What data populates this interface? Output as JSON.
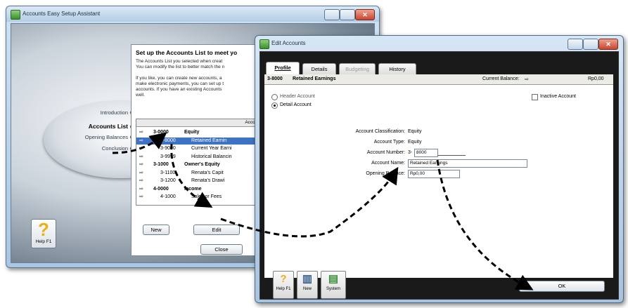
{
  "setup_window": {
    "title": "Accounts Easy Setup Assistant",
    "steps": [
      "Introduction",
      "Accounts List",
      "Opening Balances",
      "Conclusion"
    ],
    "panel_title": "Set up the Accounts List to meet yo",
    "panel_text": [
      "The Accounts List you selected when creat",
      "You can modify the list to better match the n",
      "",
      "If you like, you can create new accounts, a",
      "make electronic payments, you can set up t",
      "accounts. If you have an existing Accounts",
      "well."
    ],
    "list_header": "Accoun",
    "rows": [
      {
        "num": "3-0000",
        "name": "Equity",
        "bold": true
      },
      {
        "num": "3-8000",
        "name": "Retained Earnin",
        "selected": true
      },
      {
        "num": "3-9000",
        "name": "Current Year Earni"
      },
      {
        "num": "3-9999",
        "name": "Historical Balancin"
      },
      {
        "num": "3-1000",
        "name": "Owner's Equity",
        "bold": true
      },
      {
        "num": "3-1100",
        "name": "Renata's Capit"
      },
      {
        "num": "3-1200",
        "name": "Renata's Drawi"
      },
      {
        "num": "4-0000",
        "name": "Income",
        "bold": true
      },
      {
        "num": "4-1000",
        "name": "Sales or Fees"
      }
    ],
    "new_button": "New",
    "edit_button": "Edit",
    "close_button": "Close",
    "help_label": "Help F1"
  },
  "edit_window": {
    "title": "Edit Accounts",
    "tabs": [
      "Profile",
      "Details",
      "Budgeting",
      "History"
    ],
    "account_code": "3-8000",
    "account_title": "Retained Earnings",
    "current_balance_label": "Current Balance:",
    "current_balance": "Rp0,00",
    "header_account": "Header Account",
    "detail_account": "Detail Account",
    "inactive_account": "Inactive Account",
    "fields": {
      "classification_label": "Account Classification:",
      "classification_value": "Equity",
      "type_label": "Account Type:",
      "type_value": "Equity",
      "number_label": "Account Number:",
      "number_prefix": "3-",
      "number_value": "8000",
      "name_label": "Account Name:",
      "name_value": "Retained Earnings",
      "opening_label": "Opening Balance:",
      "opening_value": "Rp0,00"
    },
    "help_label": "Help F1",
    "new_label": "New",
    "system_label": "System",
    "ok_button": "OK"
  },
  "colors": {
    "selection": "#3e73c3",
    "dark_frame": "#1a1a1a",
    "help_icon": "#e8b018"
  }
}
